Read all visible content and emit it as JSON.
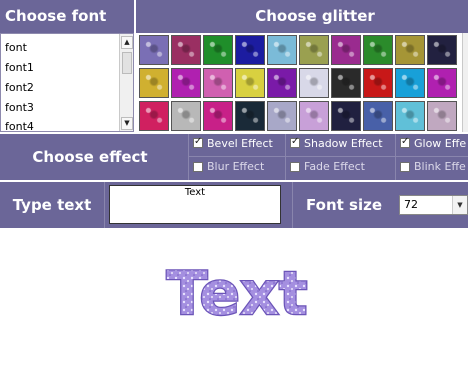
{
  "headers": {
    "choose_font": "Choose font",
    "choose_glitter": "Choose glitter"
  },
  "fonts": [
    "font",
    "font1",
    "font2",
    "font3",
    "font4"
  ],
  "glitter_swatches": [
    [
      "#7a6fb5",
      "#9a2f62",
      "#1f8e2a",
      "#1c1ca0",
      "#7bbbd8",
      "#9aa050",
      "#9a2b8f",
      "#2b8b2b",
      "#a59536",
      "#222140"
    ],
    [
      "#d0b030",
      "#b020b0",
      "#d060b0",
      "#d8d040",
      "#7a1aa8",
      "#d8d8e8",
      "#2a2a2a",
      "#c81818",
      "#18a0d8",
      "#b020b0"
    ],
    [
      "#d02060",
      "#b8b8b8",
      "#c82088",
      "#1a2a38",
      "#a8a8c8",
      "#c8a0d8",
      "#202040",
      "#4860a8",
      "#60c0d8",
      "#c0a8c0"
    ]
  ],
  "effects": {
    "section_label": "Choose effect",
    "items": [
      {
        "label": "Bevel Effect",
        "checked": true
      },
      {
        "label": "Shadow Effect",
        "checked": true
      },
      {
        "label": "Glow Effe",
        "checked": true
      },
      {
        "label": "Blur Effect",
        "checked": false
      },
      {
        "label": "Fade Effect",
        "checked": false
      },
      {
        "label": "Blink Effe",
        "checked": false
      }
    ]
  },
  "type_text": {
    "label": "Type text",
    "value": "Text"
  },
  "font_size": {
    "label": "Font size",
    "value": "72"
  },
  "preview": {
    "text": "Text",
    "color": "#a48fe0"
  },
  "colors": {
    "bar": "#6b6698",
    "accent": "#8d76d6"
  }
}
